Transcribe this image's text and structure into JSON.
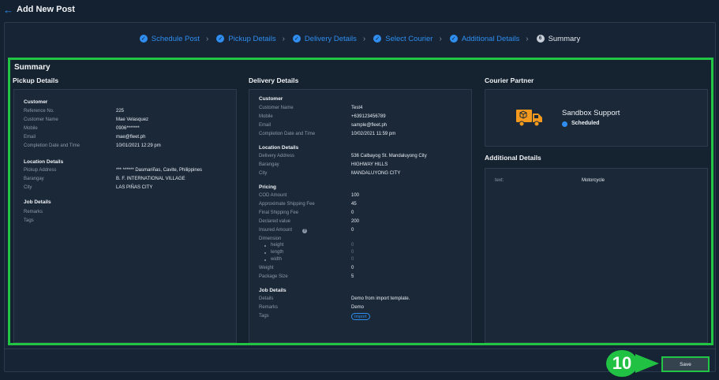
{
  "header": {
    "title": "Add New Post",
    "back_icon": "arrow-left-icon"
  },
  "stepper": {
    "steps": [
      {
        "label": "Schedule Post",
        "state": "done"
      },
      {
        "label": "Pickup Details",
        "state": "done"
      },
      {
        "label": "Delivery Details",
        "state": "done"
      },
      {
        "label": "Select Courier",
        "state": "done"
      },
      {
        "label": "Additional Details",
        "state": "done"
      },
      {
        "label": "Summary",
        "state": "current",
        "number": "6"
      }
    ],
    "separator": "›"
  },
  "summary": {
    "title": "Summary",
    "pickup": {
      "title": "Pickup Details",
      "customer_head": "Customer",
      "fields": [
        {
          "label": "Reference No.",
          "value": "225"
        },
        {
          "label": "Customer Name",
          "value": "Mae Velasquez"
        },
        {
          "label": "Mobile",
          "value": "0906*******"
        },
        {
          "label": "Email",
          "value": "mae@fleet.ph"
        },
        {
          "label": "Completion Date and Time",
          "value": "10/01/2021 12:29 pm"
        }
      ],
      "location_head": "Location Details",
      "location": [
        {
          "label": "Pickup Address",
          "value": "*** ****** Dasmariñas, Cavite, Philippines"
        },
        {
          "label": "Barangay",
          "value": "B. F. INTERNATIONAL VILLAGE"
        },
        {
          "label": "City",
          "value": "LAS PIÑAS CITY"
        }
      ],
      "job_head": "Job Details",
      "job": [
        {
          "label": "Remarks",
          "value": ""
        },
        {
          "label": "Tags",
          "value": ""
        }
      ]
    },
    "delivery": {
      "title": "Delivery Details",
      "customer_head": "Customer",
      "fields": [
        {
          "label": "Customer Name",
          "value": "Test4"
        },
        {
          "label": "Mobile",
          "value": "+639123456789"
        },
        {
          "label": "Email",
          "value": "sample@fleet.ph"
        },
        {
          "label": "Completion Date and Time",
          "value": "10/02/2021 11:59 pm"
        }
      ],
      "location_head": "Location Details",
      "location": [
        {
          "label": "Delivery Address",
          "value": "536 Calbayog St. Mandaluyong City"
        },
        {
          "label": "Barangay",
          "value": "HIGHWAY HILLS"
        },
        {
          "label": "City",
          "value": "MANDALUYONG CITY"
        }
      ],
      "pricing_head": "Pricing",
      "pricing": [
        {
          "label": "COD Amount",
          "value": "100"
        },
        {
          "label": "Approximate Shipping Fee",
          "value": "45"
        },
        {
          "label": "Final Shipping Fee",
          "value": "0"
        },
        {
          "label": "Declared value",
          "value": "200"
        },
        {
          "label": "Insured Amount",
          "value": "0",
          "help_icon": "question-circle-icon"
        }
      ],
      "dimension_label": "Dimension",
      "dimension": [
        {
          "label": "height",
          "value": "0"
        },
        {
          "label": "length",
          "value": "0"
        },
        {
          "label": "width",
          "value": "0"
        }
      ],
      "weight": {
        "label": "Weight",
        "value": "0"
      },
      "package_size": {
        "label": "Package Size",
        "value": "5"
      },
      "job_head": "Job Details",
      "job": [
        {
          "label": "Details",
          "value": "Demo from import template."
        },
        {
          "label": "Remarks",
          "value": "Demo"
        },
        {
          "label": "Tags",
          "value": "Import"
        }
      ]
    },
    "courier": {
      "title": "Courier Partner",
      "icon": "delivery-truck-icon",
      "name": "Sandbox Support",
      "status": "Scheduled",
      "icon_color": "#f39a1e"
    },
    "additional": {
      "title": "Additional Details",
      "label": "text:",
      "value": "Motorcycle"
    }
  },
  "footer": {
    "save_label": "Save",
    "step_badge": "10"
  },
  "colors": {
    "accent": "#2f8ef0",
    "highlight": "#22c443",
    "background": "#142131"
  }
}
